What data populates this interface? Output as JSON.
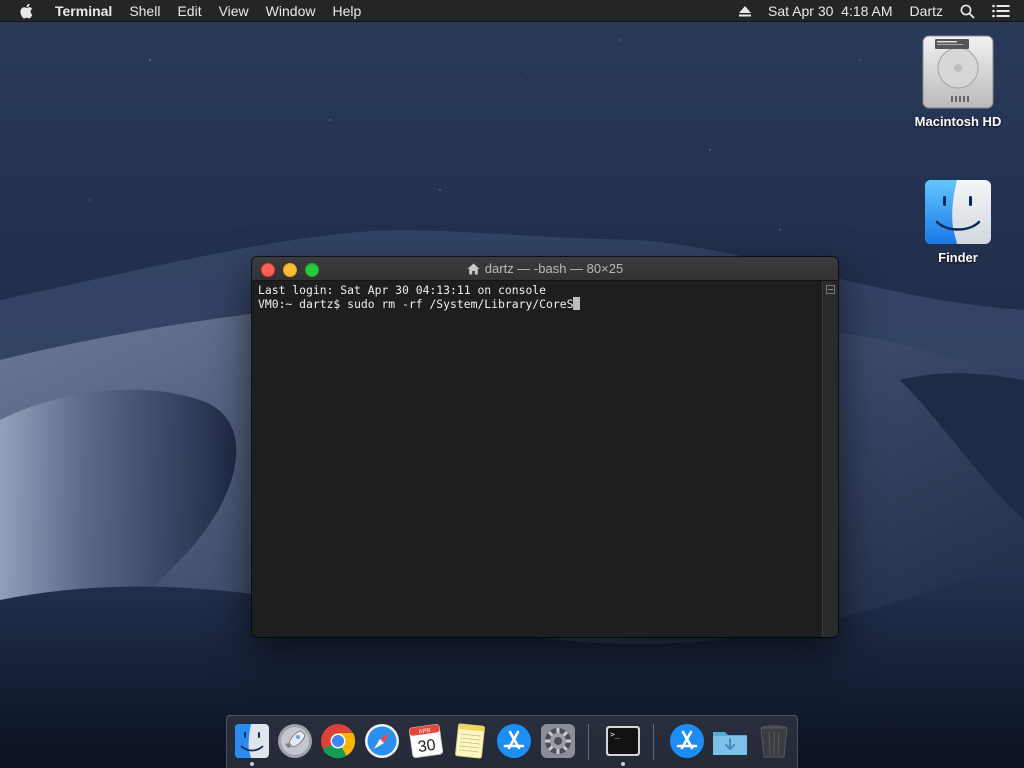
{
  "menubar": {
    "app_name": "Terminal",
    "menus": [
      "Shell",
      "Edit",
      "View",
      "Window",
      "Help"
    ],
    "clock": "Sat Apr 30  4:18 AM",
    "user": "Dartz"
  },
  "desktop": {
    "icons": [
      {
        "label": "Macintosh HD",
        "icon": "hard-drive-icon"
      },
      {
        "label": "Finder",
        "icon": "finder-icon"
      }
    ]
  },
  "terminal": {
    "title": "dartz — -bash — 80×25",
    "lines": [
      "Last login: Sat Apr 30 04:13:11 on console",
      "VM0:~ dartz$ sudo rm -rf /System/Library/CoreS"
    ]
  },
  "dock": {
    "items": [
      {
        "name": "finder",
        "icon": "finder-icon",
        "running": true
      },
      {
        "name": "launchpad",
        "icon": "rocket-icon",
        "running": false
      },
      {
        "name": "chrome",
        "icon": "chrome-icon",
        "running": false
      },
      {
        "name": "safari",
        "icon": "compass-icon",
        "running": false
      },
      {
        "name": "calendar",
        "icon": "calendar-icon",
        "running": false,
        "month": "APR",
        "day": "30"
      },
      {
        "name": "notes",
        "icon": "notes-icon",
        "running": false
      },
      {
        "name": "app-store",
        "icon": "app-store-icon",
        "running": false
      },
      {
        "name": "system-preferences",
        "icon": "gear-icon",
        "running": false
      },
      {
        "name": "terminal",
        "icon": "terminal-icon",
        "running": true,
        "prompt": ">_"
      },
      {
        "name": "app-store-downloads",
        "icon": "app-store-icon",
        "running": false
      },
      {
        "name": "downloads-folder",
        "icon": "folder-icon",
        "running": false
      },
      {
        "name": "trash",
        "icon": "trash-icon",
        "running": false
      }
    ]
  },
  "colors": {
    "menubar_bg": "#232527",
    "terminal_bg": "#1e1e1e",
    "close": "#fe5f57",
    "minimize": "#febc2e",
    "zoom": "#28c840"
  }
}
